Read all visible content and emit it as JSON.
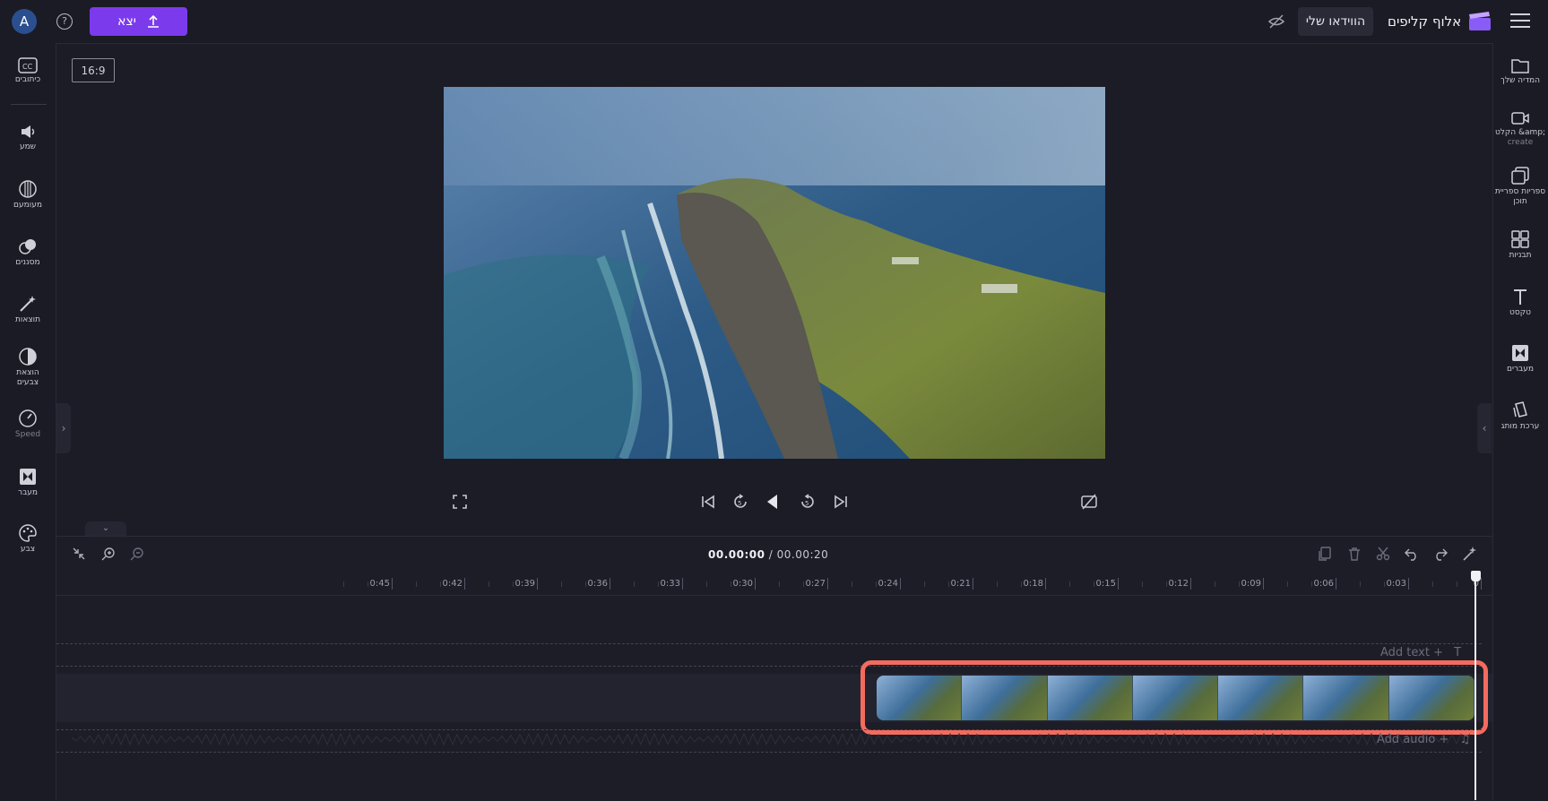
{
  "header": {
    "avatar_letter": "A",
    "help_icon": "?",
    "export_label": "יצא",
    "my_video_label": "הווידאו שלי",
    "brand_name": "אלוף קליפים"
  },
  "sidebar_left": {
    "items": [
      {
        "label": "כיתובים",
        "icon": "captions-icon"
      },
      {
        "label": "שמע",
        "icon": "audio-icon"
      },
      {
        "label": "מעומעם",
        "icon": "fade-icon"
      },
      {
        "label": "מסננים",
        "icon": "filters-icon"
      },
      {
        "label": "תוצאות",
        "icon": "effects-icon"
      },
      {
        "label": "הוצאת",
        "label2": "צבעים",
        "icon": "color-adjust-icon"
      },
      {
        "label": "Speed",
        "icon": "speed-icon"
      },
      {
        "label": "מעבר",
        "icon": "transition-icon"
      },
      {
        "label": "צבע",
        "icon": "palette-icon"
      }
    ]
  },
  "sidebar_right": {
    "items": [
      {
        "label": "המדיה שלך",
        "icon": "folder-icon"
      },
      {
        "label": "הקלט &amp;",
        "sub": "create",
        "icon": "record-icon"
      },
      {
        "label": "ספריות ספריית",
        "label2": "תוכן",
        "icon": "library-icon"
      },
      {
        "label": "תבניות",
        "icon": "templates-icon"
      },
      {
        "label": "טקסט",
        "icon": "text-icon"
      },
      {
        "label": "מעברים",
        "icon": "transitions-icon"
      },
      {
        "label": "ערכת מותג",
        "icon": "brand-kit-icon"
      }
    ]
  },
  "preview": {
    "aspect_ratio": "16:9"
  },
  "timeline": {
    "current_time": "00.00:00",
    "separator": " / ",
    "total_time": "00.00:20",
    "ticks": [
      "0",
      "0:03",
      "0:06",
      "0:09",
      "0:12",
      "0:15",
      "0:18",
      "0:21",
      "0:24",
      "0:27",
      "0:30",
      "0:33",
      "0:36",
      "0:39",
      "0:42",
      "0:45"
    ],
    "add_text_label": "Add text +",
    "add_audio_label": "Add audio +"
  },
  "colors": {
    "accent": "#7c3aed",
    "highlight": "#f36b5f"
  }
}
